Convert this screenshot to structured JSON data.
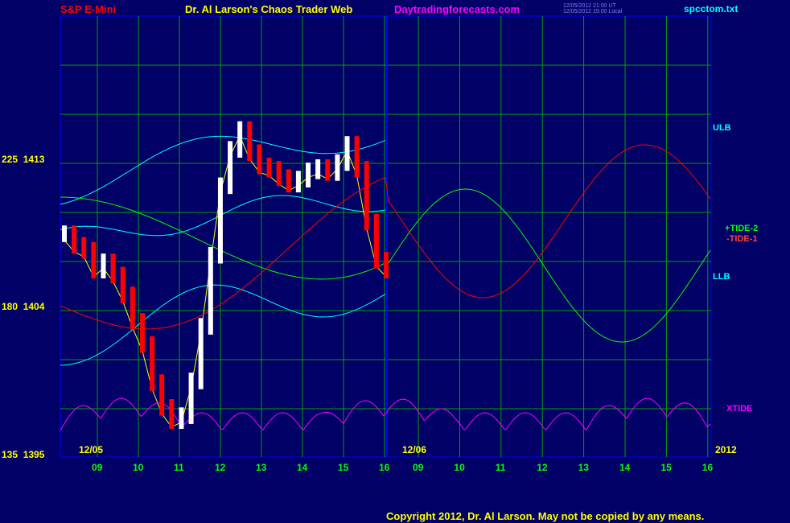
{
  "header": {
    "instrument": "S&P E-Mini",
    "title": "Dr. Al Larson's Chaos Trader Web",
    "site": "Daytradingforecasts.com",
    "file": "spcctom.txt",
    "ts_ut": "12/05/2012 21:00 UT",
    "ts_local": "12/05/2012 15:00 Local"
  },
  "colors": {
    "background": "#000066",
    "grid": "#00a000",
    "price": "#ffffff",
    "price_down": "#ff0000",
    "ulb": "#00ffff",
    "tide2": "#00ff00",
    "tide1": "#ff0000",
    "xtide": "#ff00ff",
    "divider": "#0000ff"
  },
  "labels": {
    "ulb": "ULB",
    "llb": "LLB",
    "tide2": "+TIDE-2",
    "tide1": "-TIDE-1",
    "xtide": "XTIDE"
  },
  "footer": "Copyright 2012, Dr. Al Larson. May not be copied by any means.",
  "chart_data": {
    "type": "line",
    "y_axis_ticks": [
      {
        "index": "225",
        "price": "1413"
      },
      {
        "index": "180",
        "price": "1404"
      },
      {
        "index": "135",
        "price": "1395"
      }
    ],
    "x_hours": [
      "09",
      "10",
      "11",
      "12",
      "13",
      "14",
      "15",
      "16",
      "09",
      "10",
      "11",
      "12",
      "13",
      "14",
      "15",
      "16"
    ],
    "date_labels": [
      "12/05",
      "12/06",
      "2012"
    ],
    "price": [
      1408.5,
      1407.8,
      1407.5,
      1406.3,
      1406.8,
      1406,
      1404.8,
      1403.2,
      1401.8,
      1399.5,
      1398,
      1397.2,
      1397.5,
      1399.6,
      1402.9,
      1407.2,
      1411.4,
      1413.6,
      1414.8,
      1413.4,
      1412.6,
      1412.4,
      1411.9,
      1411.5,
      1411.8,
      1412.3,
      1412.5,
      1412.2,
      1412.8,
      1413.9,
      1412.4,
      1409.2,
      1406.9,
      1406.3
    ]
  }
}
